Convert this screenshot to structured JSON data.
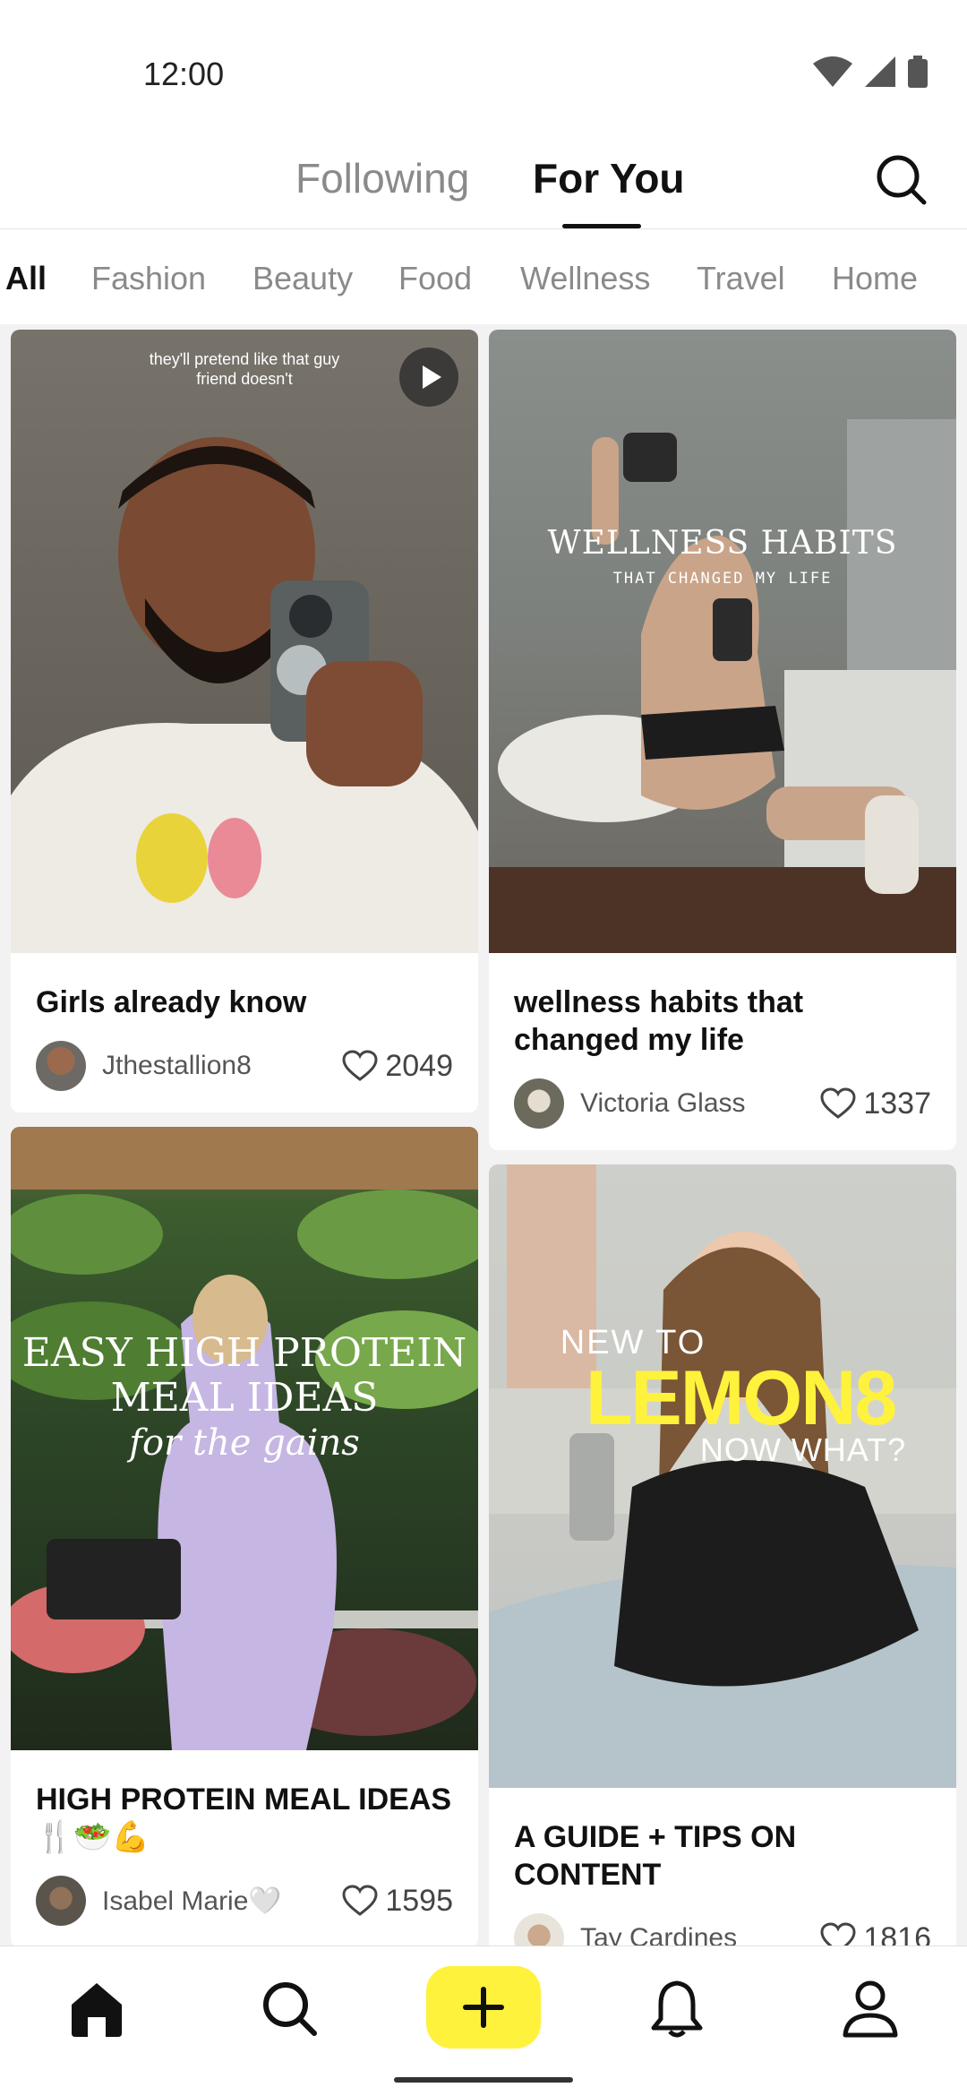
{
  "status_bar": {
    "time": "12:00"
  },
  "header": {
    "tab_following": "Following",
    "tab_foryou": "For You"
  },
  "categories": [
    "All",
    "Fashion",
    "Beauty",
    "Food",
    "Wellness",
    "Travel",
    "Home"
  ],
  "posts": [
    {
      "title": "Girls already know",
      "author": "Jthestallion8",
      "likes": "2049",
      "image_caption": "they'll pretend like that guy friend doesn't",
      "video": true
    },
    {
      "title": "wellness habits that changed my life",
      "author": "Victoria Glass",
      "likes": "1337",
      "image_headline": "WELLNESS HABITS",
      "image_subline": "THAT CHANGED MY LIFE"
    },
    {
      "title": "HIGH PROTEIN MEAL IDEAS 🍴🥗💪",
      "author": "Isabel Marie🤍",
      "likes": "1595",
      "image_headline_1": "EASY HIGH PROTEIN",
      "image_headline_2": "MEAL IDEAS",
      "image_script": "for the gains"
    },
    {
      "title": "A GUIDE + TIPS ON CONTENT",
      "author": "Tay Cardines",
      "likes": "1816",
      "image_line_1": "NEW TO",
      "image_line_2": "LEMON8",
      "image_line_3": "NOW WHAT?"
    }
  ],
  "colors": {
    "accent": "#fff23c",
    "text": "#111111",
    "muted": "#8a8a8a"
  }
}
